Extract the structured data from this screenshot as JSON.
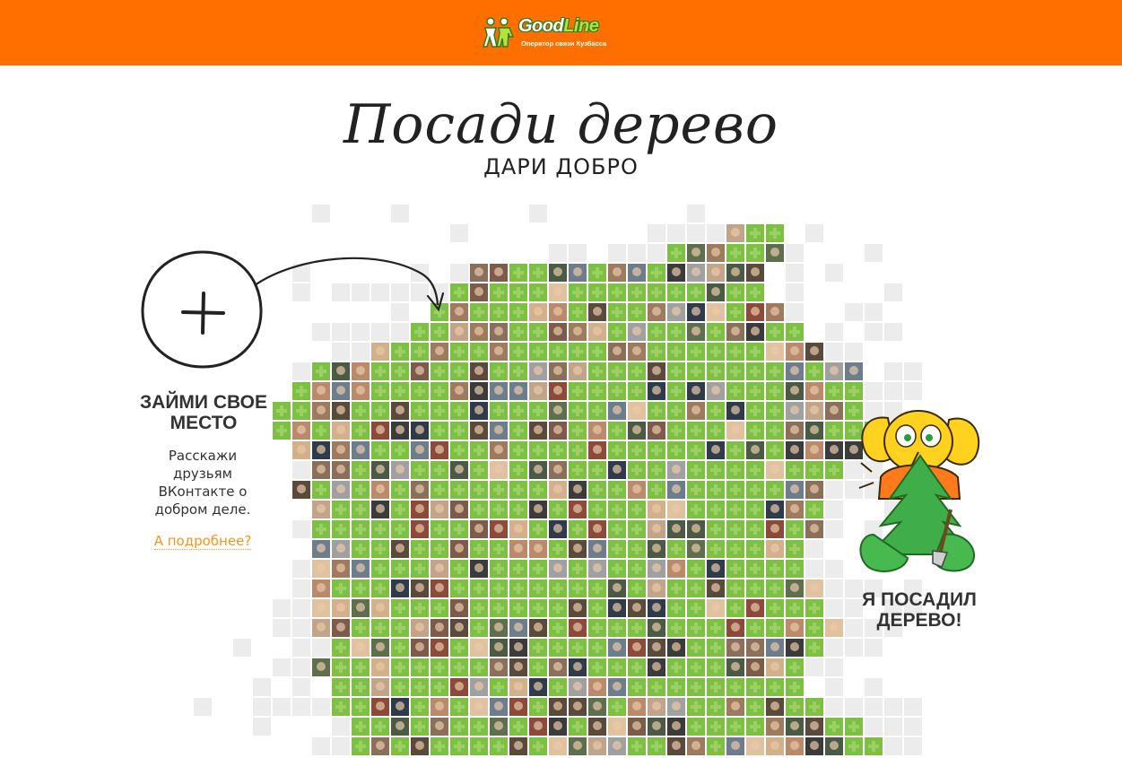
{
  "header": {
    "brand_good": "Good",
    "brand_line": "Line",
    "brand_tagline": "Оператор связи Кузбасса"
  },
  "hero": {
    "title": "Посади дерево",
    "subtitle": "ДАРИ ДОБРО"
  },
  "left_panel": {
    "plus_icon": "plus-icon",
    "title": "ЗАЙМИ СВОЕ МЕСТО",
    "text": "Расскажи друзьям ВКонтакте о добром деле.",
    "link": "А подробнее?"
  },
  "right_panel": {
    "mascot_icon": "elephant-mascot",
    "title": "Я ПОСАДИЛ ДЕРЕВО!"
  },
  "colors": {
    "header_bg": "#ff6f00",
    "tree_cell": "#7dc043",
    "tree_cell_plus": "#9bd064",
    "empty_cell": "#ececec",
    "link": "#f7941d",
    "text": "#333333"
  }
}
